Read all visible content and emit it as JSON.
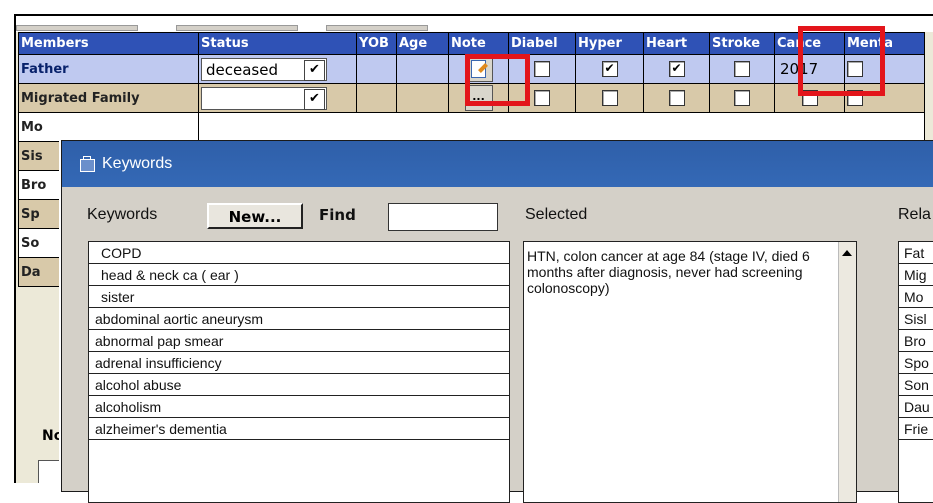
{
  "grid": {
    "headers": [
      "Members",
      "Status",
      "YOB",
      "Age",
      "Note",
      "Diabel",
      "Hyper",
      "Heart",
      "Stroke",
      "Cance",
      "Menta"
    ],
    "rows": [
      {
        "name": "Father",
        "status": "deceased",
        "checks": [
          false,
          true,
          true,
          false
        ],
        "cancer_year": "2017"
      },
      {
        "name": "Migrated Family",
        "status": "",
        "note_label": "..."
      },
      {
        "name": "Mo"
      },
      {
        "name": "Sis"
      },
      {
        "name": "Bro"
      },
      {
        "name": "Sp"
      },
      {
        "name": "So"
      },
      {
        "name": "Da"
      }
    ],
    "not_label": "Not"
  },
  "dialog": {
    "title": "Keywords",
    "keywords_label": "Keywords",
    "new_button": "New...",
    "find_label": "Find",
    "find_value": "",
    "selected_label": "Selected",
    "relation_label": "Rela",
    "keywords": [
      "COPD",
      "head & neck ca ( ear )",
      "sister",
      "abdominal aortic aneurysm",
      "abnormal pap smear",
      "adrenal insufficiency",
      "alcohol abuse",
      "alcoholism",
      "alzheimer's dementia"
    ],
    "selected_text": "HTN, colon cancer at age 84 (stage IV, died 6 months after diagnosis, never had screening colonoscopy)",
    "relations": [
      "Fat",
      "Mig",
      "Mo",
      "Sisl",
      "Bro",
      "Spo",
      "Son",
      "Dau",
      "Frie"
    ]
  },
  "colors": {
    "header_bg": "#2f52b6",
    "highlight": "#e3151b",
    "dialog_title": "#2f5fa9"
  }
}
